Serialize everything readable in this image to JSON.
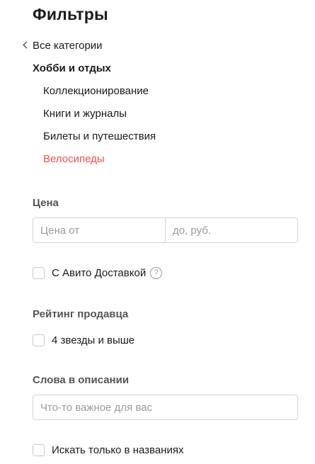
{
  "header": {
    "title": "Фильтры"
  },
  "categories": {
    "back_label": "Все категории",
    "current": "Хобби и отдых",
    "items": [
      {
        "label": "Коллекционирование",
        "active": false
      },
      {
        "label": "Книги и журналы",
        "active": false
      },
      {
        "label": "Билеты и путешествия",
        "active": false
      },
      {
        "label": "Велосипеды",
        "active": true
      }
    ]
  },
  "price": {
    "label": "Цена",
    "from_placeholder": "Цена от",
    "to_placeholder": "до, руб."
  },
  "delivery": {
    "label": "С Авито Доставкой",
    "help_glyph": "?"
  },
  "rating": {
    "label": "Рейтинг продавца",
    "option": "4 звезды и выше"
  },
  "description": {
    "label": "Слова в описании",
    "placeholder": "Что-то важное для вас",
    "titles_only_label": "Искать только в названиях"
  },
  "colors": {
    "active_category": "#f0504a",
    "text": "#1a1a1a",
    "muted": "#9a9a9a"
  }
}
